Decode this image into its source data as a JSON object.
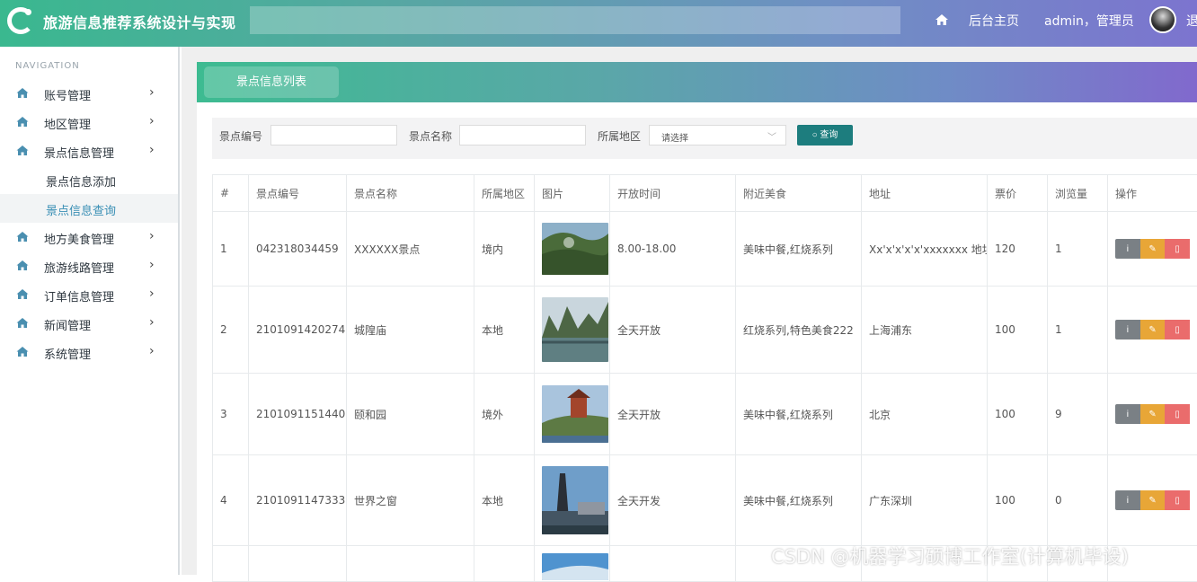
{
  "header": {
    "app_title": "旅游信息推荐系统设计与实现",
    "home_label": "后台主页",
    "user_label": "admin，管理员",
    "logout_label": "退"
  },
  "sidebar": {
    "caption": "NAVIGATION",
    "items": [
      {
        "label": "账号管理"
      },
      {
        "label": "地区管理"
      },
      {
        "label": "景点信息管理"
      },
      {
        "label": "景点信息添加"
      },
      {
        "label": "景点信息查询"
      },
      {
        "label": "地方美食管理"
      },
      {
        "label": "旅游线路管理"
      },
      {
        "label": "订单信息管理"
      },
      {
        "label": "新闻管理"
      },
      {
        "label": "系统管理"
      }
    ]
  },
  "panel": {
    "tab_label": "景点信息列表"
  },
  "filter": {
    "code_label": "景点编号",
    "name_label": "景点名称",
    "region_label": "所属地区",
    "region_value": "请选择",
    "query_label": "查询"
  },
  "table": {
    "headers": [
      "#",
      "景点编号",
      "景点名称",
      "所属地区",
      "图片",
      "开放时间",
      "附近美食",
      "地址",
      "票价",
      "浏览量",
      "操作"
    ],
    "rows": [
      {
        "idx": "1",
        "code": "042318034459",
        "name": "XXXXXX景点",
        "region": "境内",
        "hours": "8.00-18.00",
        "food": "美味中餐,红烧系列",
        "address": "Xx'x'x'x'x'xxxxxxx 地址",
        "price": "120",
        "views": "1"
      },
      {
        "idx": "2",
        "code": "2101091420274",
        "name": "城隍庙",
        "region": "本地",
        "hours": "全天开放",
        "food": "红烧系列,特色美食222",
        "address": "上海浦东",
        "price": "100",
        "views": "1"
      },
      {
        "idx": "3",
        "code": "2101091151440",
        "name": "颐和园",
        "region": "境外",
        "hours": "全天开放",
        "food": "美味中餐,红烧系列",
        "address": "北京",
        "price": "100",
        "views": "9"
      },
      {
        "idx": "4",
        "code": "2101091147333",
        "name": "世界之窗",
        "region": "本地",
        "hours": "全天开发",
        "food": "美味中餐,红烧系列",
        "address": "广东深圳",
        "price": "100",
        "views": "0"
      }
    ]
  },
  "watermark": "CSDN @机器学习硕博工作室(计算机毕设)"
}
